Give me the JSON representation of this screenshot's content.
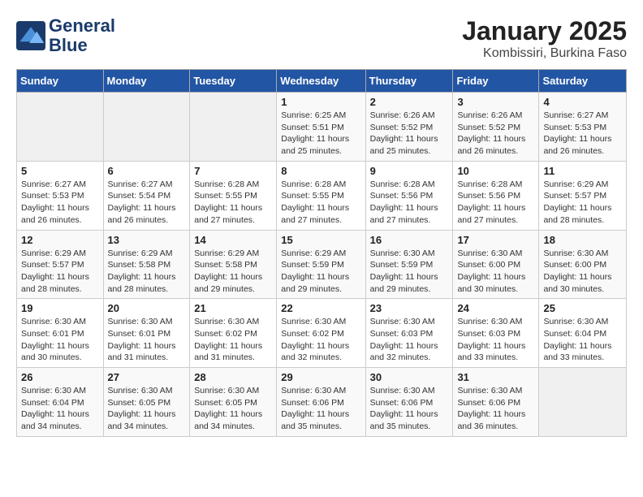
{
  "header": {
    "logo_line1": "General",
    "logo_line2": "Blue",
    "title": "January 2025",
    "subtitle": "Kombissiri, Burkina Faso"
  },
  "weekdays": [
    "Sunday",
    "Monday",
    "Tuesday",
    "Wednesday",
    "Thursday",
    "Friday",
    "Saturday"
  ],
  "weeks": [
    [
      {
        "day": "",
        "info": ""
      },
      {
        "day": "",
        "info": ""
      },
      {
        "day": "",
        "info": ""
      },
      {
        "day": "1",
        "info": "Sunrise: 6:25 AM\nSunset: 5:51 PM\nDaylight: 11 hours and 25 minutes."
      },
      {
        "day": "2",
        "info": "Sunrise: 6:26 AM\nSunset: 5:52 PM\nDaylight: 11 hours and 25 minutes."
      },
      {
        "day": "3",
        "info": "Sunrise: 6:26 AM\nSunset: 5:52 PM\nDaylight: 11 hours and 26 minutes."
      },
      {
        "day": "4",
        "info": "Sunrise: 6:27 AM\nSunset: 5:53 PM\nDaylight: 11 hours and 26 minutes."
      }
    ],
    [
      {
        "day": "5",
        "info": "Sunrise: 6:27 AM\nSunset: 5:53 PM\nDaylight: 11 hours and 26 minutes."
      },
      {
        "day": "6",
        "info": "Sunrise: 6:27 AM\nSunset: 5:54 PM\nDaylight: 11 hours and 26 minutes."
      },
      {
        "day": "7",
        "info": "Sunrise: 6:28 AM\nSunset: 5:55 PM\nDaylight: 11 hours and 27 minutes."
      },
      {
        "day": "8",
        "info": "Sunrise: 6:28 AM\nSunset: 5:55 PM\nDaylight: 11 hours and 27 minutes."
      },
      {
        "day": "9",
        "info": "Sunrise: 6:28 AM\nSunset: 5:56 PM\nDaylight: 11 hours and 27 minutes."
      },
      {
        "day": "10",
        "info": "Sunrise: 6:28 AM\nSunset: 5:56 PM\nDaylight: 11 hours and 27 minutes."
      },
      {
        "day": "11",
        "info": "Sunrise: 6:29 AM\nSunset: 5:57 PM\nDaylight: 11 hours and 28 minutes."
      }
    ],
    [
      {
        "day": "12",
        "info": "Sunrise: 6:29 AM\nSunset: 5:57 PM\nDaylight: 11 hours and 28 minutes."
      },
      {
        "day": "13",
        "info": "Sunrise: 6:29 AM\nSunset: 5:58 PM\nDaylight: 11 hours and 28 minutes."
      },
      {
        "day": "14",
        "info": "Sunrise: 6:29 AM\nSunset: 5:58 PM\nDaylight: 11 hours and 29 minutes."
      },
      {
        "day": "15",
        "info": "Sunrise: 6:29 AM\nSunset: 5:59 PM\nDaylight: 11 hours and 29 minutes."
      },
      {
        "day": "16",
        "info": "Sunrise: 6:30 AM\nSunset: 5:59 PM\nDaylight: 11 hours and 29 minutes."
      },
      {
        "day": "17",
        "info": "Sunrise: 6:30 AM\nSunset: 6:00 PM\nDaylight: 11 hours and 30 minutes."
      },
      {
        "day": "18",
        "info": "Sunrise: 6:30 AM\nSunset: 6:00 PM\nDaylight: 11 hours and 30 minutes."
      }
    ],
    [
      {
        "day": "19",
        "info": "Sunrise: 6:30 AM\nSunset: 6:01 PM\nDaylight: 11 hours and 30 minutes."
      },
      {
        "day": "20",
        "info": "Sunrise: 6:30 AM\nSunset: 6:01 PM\nDaylight: 11 hours and 31 minutes."
      },
      {
        "day": "21",
        "info": "Sunrise: 6:30 AM\nSunset: 6:02 PM\nDaylight: 11 hours and 31 minutes."
      },
      {
        "day": "22",
        "info": "Sunrise: 6:30 AM\nSunset: 6:02 PM\nDaylight: 11 hours and 32 minutes."
      },
      {
        "day": "23",
        "info": "Sunrise: 6:30 AM\nSunset: 6:03 PM\nDaylight: 11 hours and 32 minutes."
      },
      {
        "day": "24",
        "info": "Sunrise: 6:30 AM\nSunset: 6:03 PM\nDaylight: 11 hours and 33 minutes."
      },
      {
        "day": "25",
        "info": "Sunrise: 6:30 AM\nSunset: 6:04 PM\nDaylight: 11 hours and 33 minutes."
      }
    ],
    [
      {
        "day": "26",
        "info": "Sunrise: 6:30 AM\nSunset: 6:04 PM\nDaylight: 11 hours and 34 minutes."
      },
      {
        "day": "27",
        "info": "Sunrise: 6:30 AM\nSunset: 6:05 PM\nDaylight: 11 hours and 34 minutes."
      },
      {
        "day": "28",
        "info": "Sunrise: 6:30 AM\nSunset: 6:05 PM\nDaylight: 11 hours and 34 minutes."
      },
      {
        "day": "29",
        "info": "Sunrise: 6:30 AM\nSunset: 6:06 PM\nDaylight: 11 hours and 35 minutes."
      },
      {
        "day": "30",
        "info": "Sunrise: 6:30 AM\nSunset: 6:06 PM\nDaylight: 11 hours and 35 minutes."
      },
      {
        "day": "31",
        "info": "Sunrise: 6:30 AM\nSunset: 6:06 PM\nDaylight: 11 hours and 36 minutes."
      },
      {
        "day": "",
        "info": ""
      }
    ]
  ]
}
